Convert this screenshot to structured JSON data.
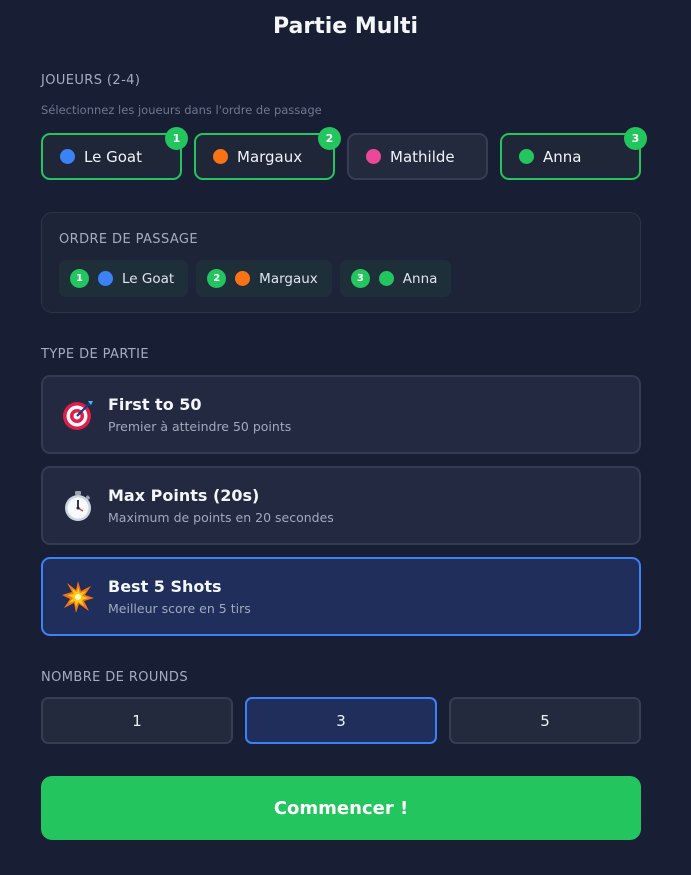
{
  "header": {
    "title": "Partie Multi"
  },
  "players_section": {
    "label": "JOUEURS (2-4)",
    "hint": "Sélectionnez les joueurs dans l'ordre de passage",
    "players": [
      {
        "name": "Le Goat",
        "color": "#3b82f6",
        "selected": true,
        "order": "1"
      },
      {
        "name": "Margaux",
        "color": "#f97316",
        "selected": true,
        "order": "2"
      },
      {
        "name": "Mathilde",
        "color": "#ec4899",
        "selected": false,
        "order": ""
      },
      {
        "name": "Anna",
        "color": "#22c55e",
        "selected": true,
        "order": "3"
      }
    ]
  },
  "order_section": {
    "label": "ORDRE DE PASSAGE",
    "items": [
      {
        "num": "1",
        "name": "Le Goat",
        "color": "#3b82f6"
      },
      {
        "num": "2",
        "name": "Margaux",
        "color": "#f97316"
      },
      {
        "num": "3",
        "name": "Anna",
        "color": "#22c55e"
      }
    ]
  },
  "game_type_section": {
    "label": "TYPE DE PARTIE",
    "modes": [
      {
        "title": "First to 50",
        "subtitle": "Premier à atteindre 50 points",
        "icon": "target-icon",
        "active": false
      },
      {
        "title": "Max Points (20s)",
        "subtitle": "Maximum de points en 20 secondes",
        "icon": "stopwatch-icon",
        "active": false
      },
      {
        "title": "Best 5 Shots",
        "subtitle": "Meilleur score en 5 tirs",
        "icon": "explosion-icon",
        "active": true
      }
    ]
  },
  "rounds_section": {
    "label": "NOMBRE DE ROUNDS",
    "options": [
      "1",
      "3",
      "5"
    ],
    "selected": "3"
  },
  "start_button": {
    "label": "Commencer !"
  },
  "colors": {
    "background": "#181e33",
    "accent_green": "#22c55e",
    "accent_blue": "#3b82f6"
  }
}
